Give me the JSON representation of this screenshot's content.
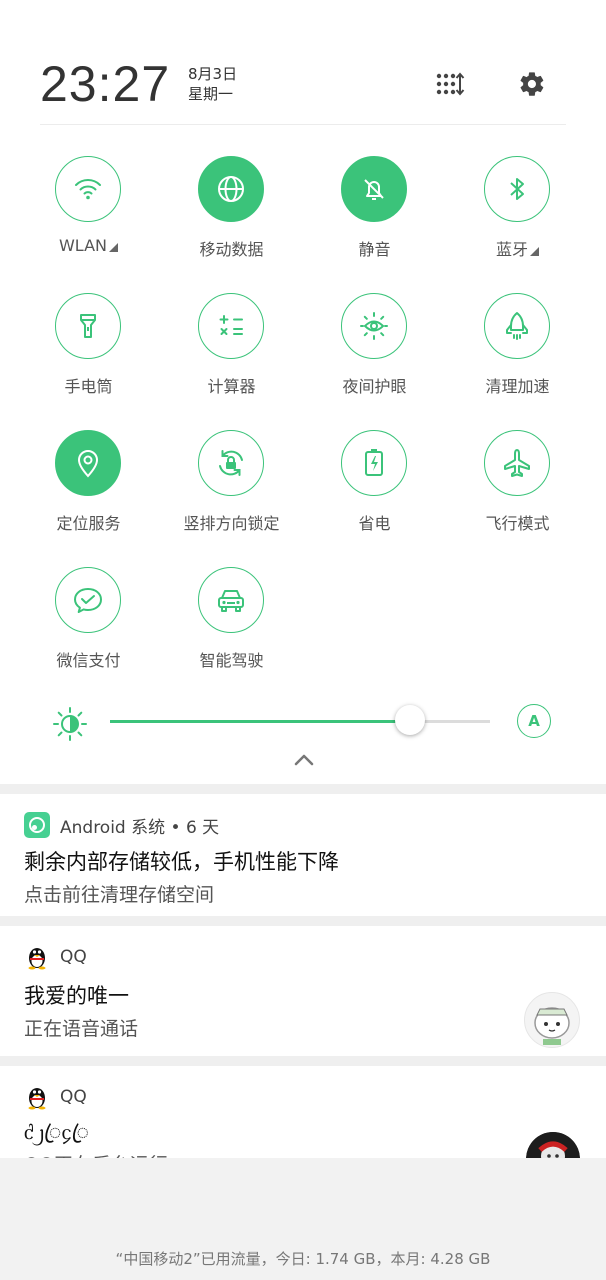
{
  "header": {
    "time": "23:27",
    "date": "8月3日",
    "weekday": "星期一"
  },
  "tiles": [
    {
      "label": "WLAN",
      "icon": "wifi-icon",
      "on": false,
      "dropdown": true
    },
    {
      "label": "移动数据",
      "icon": "globe-icon",
      "on": true,
      "dropdown": false
    },
    {
      "label": "静音",
      "icon": "bell-off-icon",
      "on": true,
      "dropdown": false
    },
    {
      "label": "蓝牙",
      "icon": "bluetooth-icon",
      "on": false,
      "dropdown": true
    },
    {
      "label": "手电筒",
      "icon": "flashlight-icon",
      "on": false
    },
    {
      "label": "计算器",
      "icon": "calculator-icon",
      "on": false
    },
    {
      "label": "夜间护眼",
      "icon": "eye-sun-icon",
      "on": false
    },
    {
      "label": "清理加速",
      "icon": "rocket-icon",
      "on": false
    },
    {
      "label": "定位服务",
      "icon": "location-pin-icon",
      "on": true
    },
    {
      "label": "竖排方向锁定",
      "icon": "rotation-lock-icon",
      "on": false
    },
    {
      "label": "省电",
      "icon": "battery-saver-icon",
      "on": false
    },
    {
      "label": "飞行模式",
      "icon": "airplane-icon",
      "on": false
    },
    {
      "label": "微信支付",
      "icon": "wechat-pay-icon",
      "on": false
    },
    {
      "label": "智能驾驶",
      "icon": "car-icon",
      "on": false
    }
  ],
  "brightness": {
    "level": 0.79,
    "auto_label": "A"
  },
  "notifications": [
    {
      "app": "Android 系统 • 6 天",
      "title": "剩余内部存储较低，手机性能下降",
      "text": "点击前往清理存储空间",
      "icon": "android-system-icon"
    },
    {
      "app": "QQ",
      "title": "我爱的唯一",
      "text": "正在语音通话",
      "icon": "qq-penguin-icon"
    },
    {
      "app": "QQ",
      "title": "ᦺ᧒ꦿ᧔ꦿ",
      "text": "QQ正在后台运行",
      "icon": "qq-penguin-icon"
    }
  ],
  "footer": {
    "data_usage": "“中国移动2”已用流量，今日: 1.74 GB，本月: 4.28 GB"
  },
  "colors": {
    "accent": "#3bc37a"
  }
}
